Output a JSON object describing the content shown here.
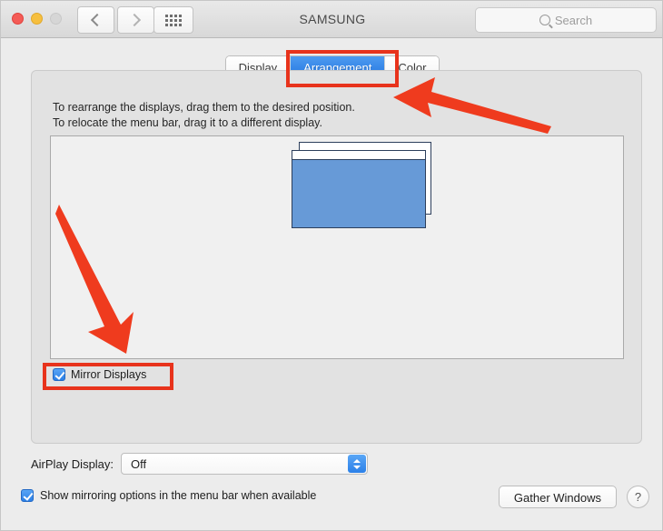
{
  "window": {
    "title": "SAMSUNG",
    "traffic_lights": [
      {
        "name": "close",
        "color": "#f45b56"
      },
      {
        "name": "minimize",
        "color": "#f6bf3f"
      },
      {
        "name": "zoom",
        "color": "#d6d6d6"
      }
    ],
    "nav": {
      "back_icon": "chevron-left-icon",
      "forward_icon": "chevron-right-icon",
      "grid_icon": "show-all-grid-icon"
    },
    "search": {
      "placeholder": "Search",
      "icon": "search-icon"
    }
  },
  "tabs": [
    {
      "label": "Display",
      "active": false
    },
    {
      "label": "Arrangement",
      "active": true
    },
    {
      "label": "Color",
      "active": false
    }
  ],
  "panel": {
    "instruction_line1": "To rearrange the displays, drag them to the desired position.",
    "instruction_line2": "To relocate the menu bar, drag it to a different display.",
    "displays": {
      "count": 2,
      "front_color": "#679ad7",
      "menu_bar_on_front": true
    },
    "mirror": {
      "label": "Mirror Displays",
      "checked": true
    }
  },
  "bottom": {
    "airplay_label": "AirPlay Display:",
    "airplay_value": "Off",
    "airplay_options": [
      "Off"
    ],
    "show_mirroring_label": "Show mirroring options in the menu bar when available",
    "show_mirroring_checked": true,
    "gather_windows_label": "Gather Windows",
    "help_label": "?"
  },
  "annotations": {
    "accent_color": "#e8331c",
    "highlight_tab": "Arrangement",
    "highlight_checkbox": "Mirror Displays",
    "arrow_to_tab": "arrow pointing up-left at Arrangement tab",
    "arrow_to_checkbox": "arrow pointing down-right at Mirror Displays checkbox"
  }
}
